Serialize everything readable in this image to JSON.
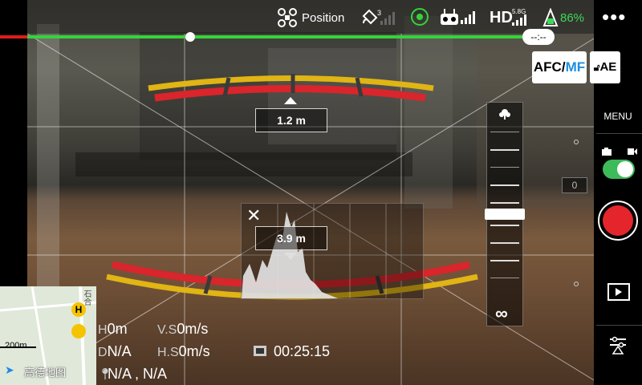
{
  "colors": {
    "signal_green": "#33d43a",
    "battery_green": "#3dd95a",
    "record_red": "#e4262c",
    "guide_red": "#d9252b",
    "guide_yellow": "#e0b514",
    "progress_red": "#e21b1b"
  },
  "top_bar": {
    "flight_mode": "Position",
    "gps_count": "3",
    "hd_band": "5.8G",
    "hd_label": "HD",
    "battery": "86%"
  },
  "progress": {
    "fraction": 0.3,
    "time_label": "--:--"
  },
  "focus": {
    "afc_label": "AFC/",
    "mf_label": "MF",
    "ae_label": "AE",
    "near_distance": "1.2 m",
    "far_distance": "3.9 m",
    "slider_inf": "∞",
    "slider_position": 0.5
  },
  "right_panel": {
    "menu_label": "MENU",
    "ev_value": "0"
  },
  "telemetry": {
    "h_label": "H",
    "h_value": "0m",
    "vs_label": "V.S",
    "vs_value": "0m/s",
    "d_label": "D",
    "d_value": "N/A",
    "hs_label": "H.S",
    "hs_value": "0m/s",
    "sd_time": "00:25:15",
    "location": "N/A , N/A"
  },
  "map": {
    "scale": "200m",
    "brand": "高德地图",
    "road_label": "石合",
    "home_marker": "H"
  },
  "icons": [
    "drone-icon",
    "satellite-icon",
    "signal-icon",
    "remote-controller-icon",
    "battery-icon",
    "more-icon",
    "lock-icon",
    "camera-icon",
    "video-icon",
    "playback-icon",
    "settings-sliders-icon",
    "close-icon",
    "macro-flower-icon",
    "sd-card-icon",
    "location-pin-icon",
    "home-marker-icon"
  ]
}
